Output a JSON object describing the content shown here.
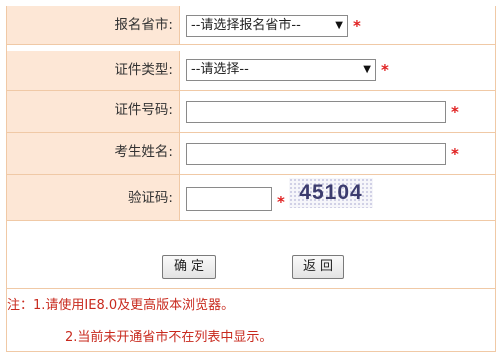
{
  "form": {
    "province": {
      "label": "报名省市:",
      "selected": "--请选择报名省市--",
      "required": "*"
    },
    "id_type": {
      "label": "证件类型:",
      "selected": "--请选择--",
      "required": "*"
    },
    "id_number": {
      "label": "证件号码:",
      "value": "",
      "required": "*"
    },
    "name": {
      "label": "考生姓名:",
      "value": "",
      "required": "*"
    },
    "captcha": {
      "label": "验证码:",
      "value": "",
      "required": "*",
      "image_text": "45104"
    }
  },
  "buttons": {
    "confirm": "确定",
    "back": "返回"
  },
  "notes": {
    "line1": "注：1.请使用IE8.0及更高版本浏览器。",
    "line2": "2.当前未开通省市不在列表中显示。"
  },
  "colors": {
    "label_bg": "#fde7d6",
    "border": "#f0c9a6",
    "required": "#e02020",
    "note": "#c82a1e"
  },
  "icons": {
    "dropdown": "triangle-down-icon"
  }
}
